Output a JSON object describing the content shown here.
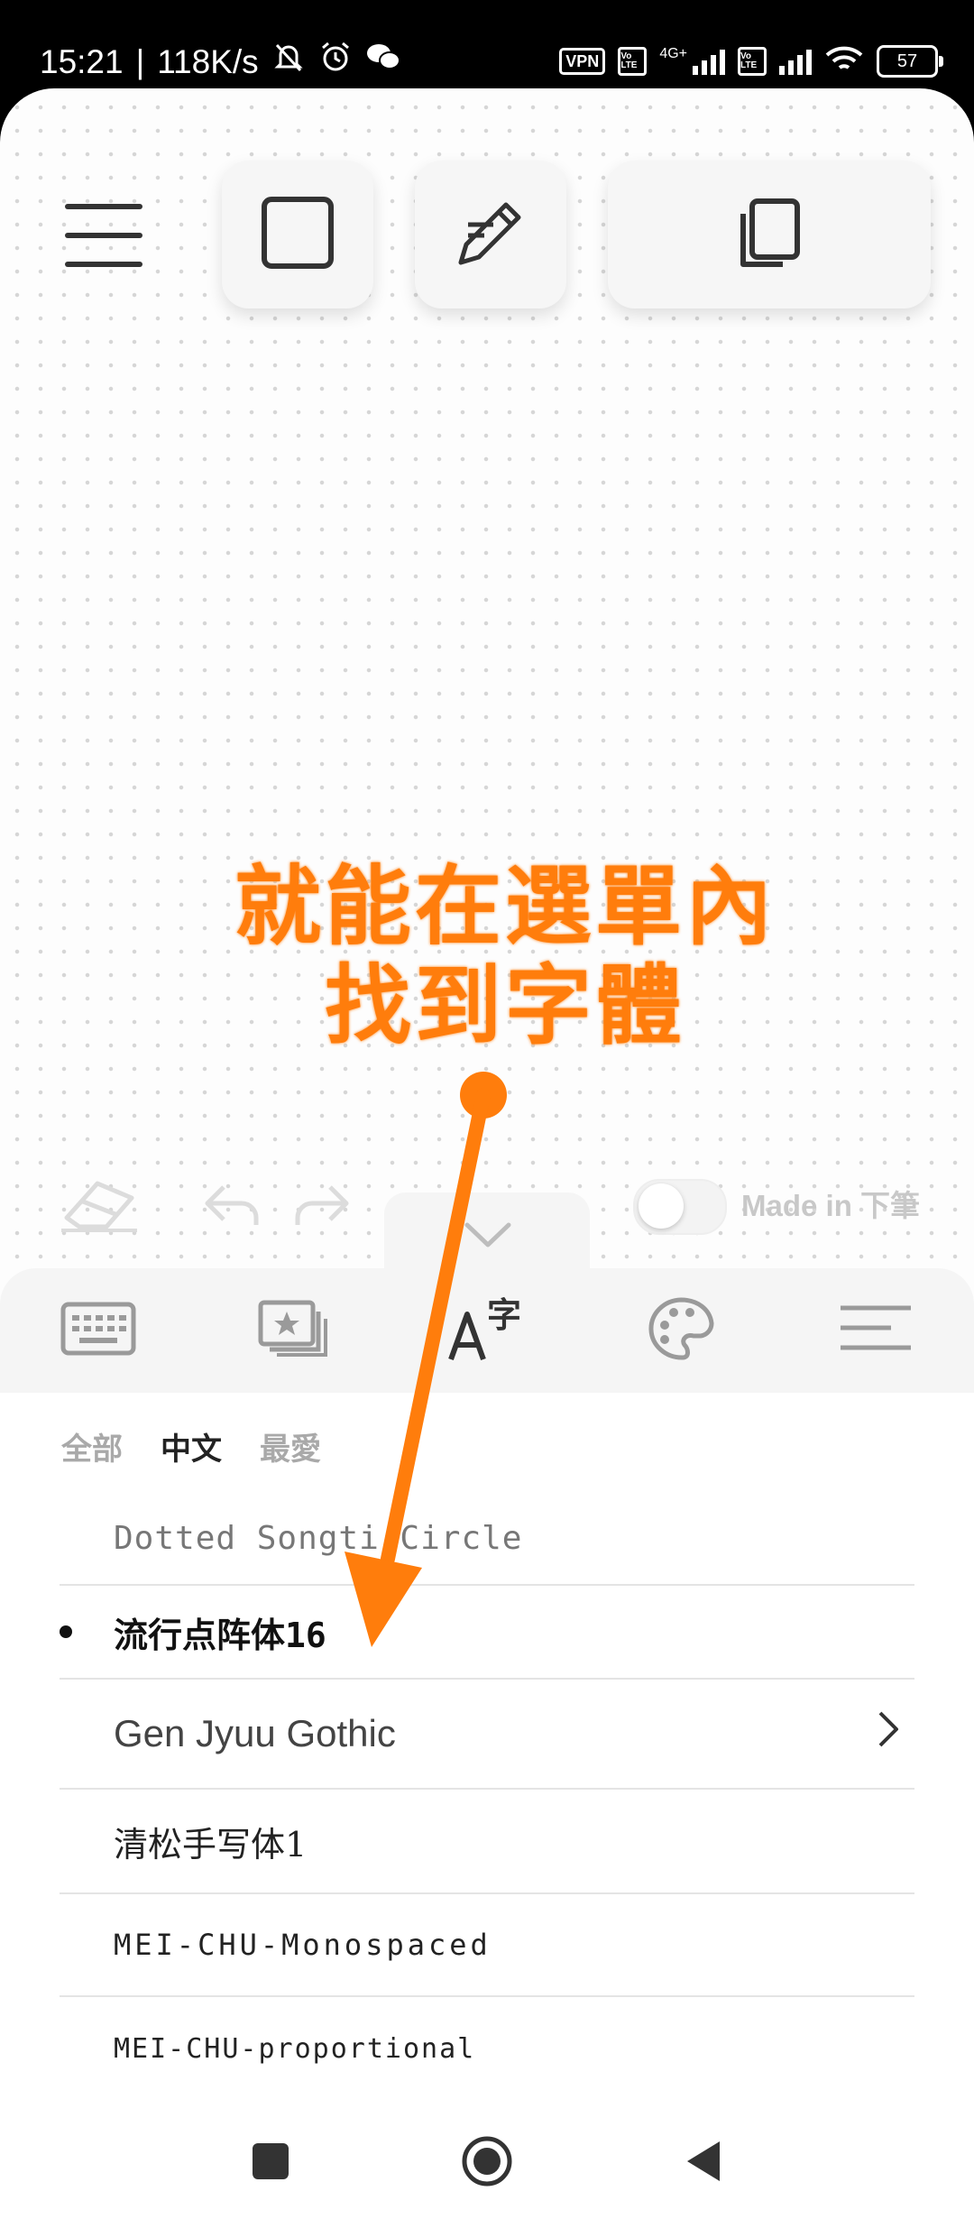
{
  "status_bar": {
    "time": "15:21",
    "separator": "|",
    "net_speed": "118K/s",
    "vpn": "VPN",
    "volte": "Vo LTE",
    "network": "4G+",
    "battery": "57"
  },
  "toolbar": {
    "menu_icon": "hamburger-icon",
    "icons": [
      "square-icon",
      "pencil-icon",
      "copy-icon"
    ]
  },
  "annotation": {
    "line1": "就能在選單內",
    "line2": "找到字體",
    "color": "#ff7d0c"
  },
  "canvas_controls": {
    "icons": [
      "eraser-icon",
      "undo-icon",
      "redo-icon"
    ],
    "toggle_on": false,
    "made_label": "Made in 下筆"
  },
  "panel_tabs": [
    "keyboard-icon",
    "stickers-icon",
    "font-icon",
    "palette-icon",
    "menu-lines-icon"
  ],
  "categories": [
    {
      "label": "全部",
      "active": false
    },
    {
      "label": "中文",
      "active": true
    },
    {
      "label": "最愛",
      "active": false
    }
  ],
  "fonts": [
    {
      "label": "Dotted Songti Circle",
      "selected": false,
      "has_submenu": false
    },
    {
      "label": "流行点阵体16",
      "selected": true,
      "has_submenu": false
    },
    {
      "label": "Gen Jyuu Gothic",
      "selected": false,
      "has_submenu": true
    },
    {
      "label": "清松手写体1",
      "selected": false,
      "has_submenu": false
    },
    {
      "label": "MEI-CHU-Monospaced",
      "selected": false,
      "has_submenu": false
    },
    {
      "label": "MEI-CHU-proportional",
      "selected": false,
      "has_submenu": false
    }
  ],
  "nav_bar": [
    "recents-icon",
    "home-icon",
    "back-icon"
  ]
}
